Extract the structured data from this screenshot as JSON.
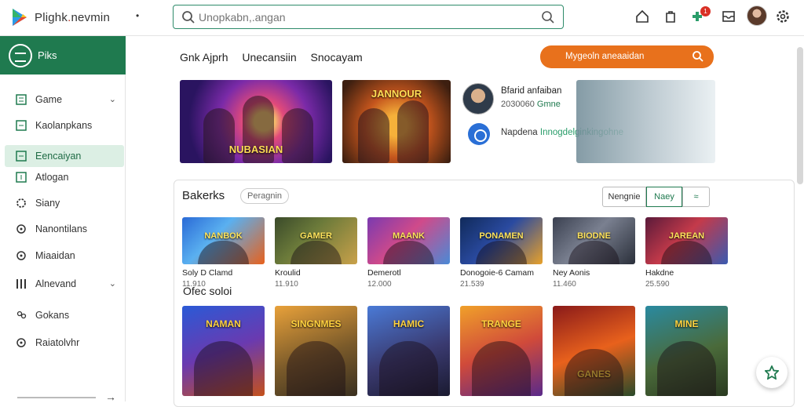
{
  "app": {
    "brand_main": "Plighk",
    "brand_accent": ".",
    "brand_rest": "nevmin"
  },
  "topbar": {
    "dropdown": "•",
    "search_placeholder": "Unopkabn,.angan",
    "badge_count": "1"
  },
  "sidebar": {
    "header": "Piks",
    "items": [
      {
        "label": "Game",
        "chevron": "⌄"
      },
      {
        "label": "Kaolanpkans"
      },
      {
        "label": "Eencaiyan"
      },
      {
        "label": "Atlogan"
      },
      {
        "label": "Siany"
      },
      {
        "label": "Nanontilans"
      },
      {
        "label": "Miaaidan"
      },
      {
        "label": "Alnevand",
        "chevron": "⌄"
      },
      {
        "label": "Gokans"
      },
      {
        "label": "Raiatolvhr"
      }
    ],
    "arrow": "→"
  },
  "main": {
    "tabs": [
      "Gnk Ajprh",
      "Unecansiin",
      "Snocayam"
    ],
    "cta": "Mygeoln aneaaidan",
    "banners": [
      {
        "caption": "NUBASIAN"
      },
      {
        "caption": "JANNOUR"
      }
    ],
    "promo": {
      "name": "Bfarid anfaiban",
      "sub_prefix": "2030060",
      "sub_accent": "Gmne",
      "label_prefix": "Napdena",
      "label_accent": "Innogdelginkingohne"
    },
    "panel": {
      "title": "Bakerks",
      "chip": "Peragnin",
      "segments": [
        "Nengnie",
        "Naey",
        "≈"
      ],
      "row1": [
        {
          "title": "Soly D Clamd",
          "price": "11.910",
          "art": "NANBOK"
        },
        {
          "title": "Kroulid",
          "price": "11.910",
          "art": "GAMER"
        },
        {
          "title": "Demerotl",
          "price": "12.000",
          "art": "MAANK"
        },
        {
          "title": "Donogoie-6 Camam",
          "price": "21.539",
          "art": "PONAMEN"
        },
        {
          "title": "Ney Aonis",
          "price": "11.460",
          "art": "BIODNE"
        },
        {
          "title": "Hakdne",
          "price": "25.590",
          "art": "JAREAN"
        }
      ],
      "subtitle": "Ofec soloi",
      "row2": [
        {
          "art": "NAMAN"
        },
        {
          "art": "SINGNMES"
        },
        {
          "art": "HAMIC"
        },
        {
          "art": "TRANGE"
        },
        {
          "art": "GANES"
        },
        {
          "art": "MINE"
        }
      ]
    }
  },
  "colors": {
    "primary_green": "#1f7a4f",
    "accent_orange": "#e8711c",
    "badge_red": "#d93025"
  }
}
